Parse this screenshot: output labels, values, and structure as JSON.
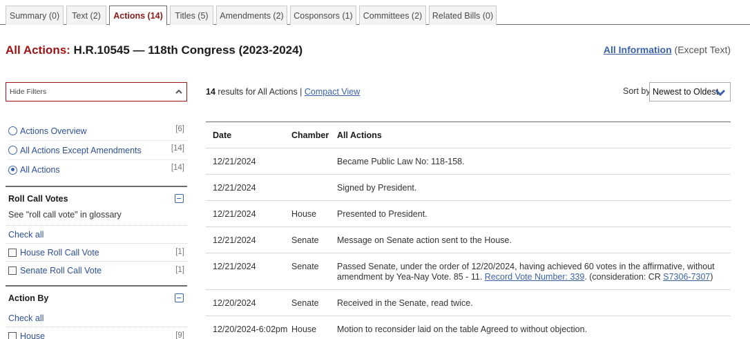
{
  "tabs": [
    {
      "label": "Summary (0)"
    },
    {
      "label": "Text (2)"
    },
    {
      "label": "Actions (14)"
    },
    {
      "label": "Titles (5)"
    },
    {
      "label": "Amendments (2)"
    },
    {
      "label": "Cosponsors (1)"
    },
    {
      "label": "Committees (2)"
    },
    {
      "label": "Related Bills (0)"
    }
  ],
  "header": {
    "title_prefix": "All Actions",
    "title_colon": ":",
    "title_rest": " H.R.10545 — 118th Congress (2023-2024)",
    "all_info_link": "All Information",
    "all_info_suffix": " (Except Text)"
  },
  "filters": {
    "hide_label": "Hide Filters",
    "views": [
      {
        "label": "Actions Overview",
        "count": "[6]",
        "checked": false
      },
      {
        "label": "All Actions Except Amendments",
        "count": "[14]",
        "checked": false
      },
      {
        "label": "All Actions",
        "count": "[14]",
        "checked": true
      }
    ],
    "roll_call": {
      "title": "Roll Call Votes",
      "glossary": "See \"roll call vote\" in glossary",
      "check_all": "Check all",
      "items": [
        {
          "label": "House Roll Call Vote",
          "count": "[1]"
        },
        {
          "label": "Senate Roll Call Vote",
          "count": "[1]"
        }
      ]
    },
    "action_by": {
      "title": "Action By",
      "check_all": "Check all",
      "items": [
        {
          "label": "House",
          "count": "[9]"
        }
      ]
    }
  },
  "results": {
    "count": "14",
    "text": " results for All Actions | ",
    "compact_link": "Compact View",
    "sort_label": "Sort by",
    "sort_value": "Newest to Oldest"
  },
  "table": {
    "headers": {
      "date": "Date",
      "chamber": "Chamber",
      "action": "All Actions"
    },
    "rows": [
      {
        "date": "12/21/2024",
        "chamber": "",
        "action": "Became Public Law No: 118-158."
      },
      {
        "date": "12/21/2024",
        "chamber": "",
        "action": "Signed by President."
      },
      {
        "date": "12/21/2024",
        "chamber": "House",
        "action": "Presented to President."
      },
      {
        "date": "12/21/2024",
        "chamber": "Senate",
        "action": "Message on Senate action sent to the House."
      },
      {
        "date": "12/21/2024",
        "chamber": "Senate",
        "action_pre": "Passed Senate, under the order of 12/20/2024, having achieved 60 votes in the affirmative, without amendment by Yea-Nay Vote. 85 - 11. ",
        "action_link1": "Record Vote Number: 339",
        "action_mid": ". (consideration: CR ",
        "action_link2": "S7306-7307",
        "action_post": ")"
      },
      {
        "date": "12/20/2024",
        "chamber": "Senate",
        "action": "Received in the Senate, read twice."
      },
      {
        "date": "12/20/2024-6:02pm",
        "chamber": "House",
        "action": "Motion to reconsider laid on the table Agreed to without objection."
      }
    ]
  },
  "colors": {
    "accent_red": "#9b1414",
    "link_blue": "#3a62a8"
  }
}
